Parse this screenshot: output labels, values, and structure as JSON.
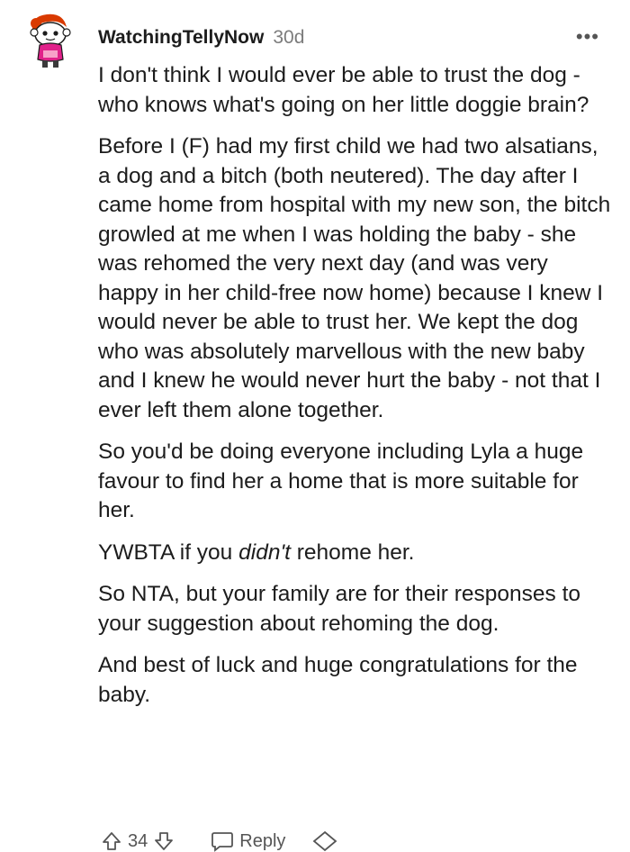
{
  "comment": {
    "username": "WatchingTellyNow",
    "age": "30d",
    "more": "•••",
    "paragraphs": [
      "I don't think I would ever be able to trust the dog - who knows what's going on her little doggie brain?",
      "Before I (F) had my first child we had two alsatians, a dog and a bitch (both neutered). The day after I came home from hospital with my new son, the bitch growled at me when I was holding the baby - she was rehomed the very next day (and was very happy in her child-free now home) because I knew I would never be able to trust her. We kept the dog who was absolutely marvellous with the new baby and I knew he would never hurt the baby - not that I ever left them alone together.",
      "So you'd be doing everyone including Lyla a huge favour to find her a home that is more suitable for her."
    ],
    "p4_before": "YWBTA if you ",
    "p4_italic": "didn't",
    "p4_after": " rehome her.",
    "paragraphs_end": [
      "So NTA, but your family are for their responses to your suggestion about rehoming the dog.",
      "And best of luck and huge congratulations for the baby."
    ]
  },
  "actions": {
    "vote_count": "34",
    "reply_label": "Reply"
  },
  "icons": {
    "avatar": "snoo-avatar-icon",
    "upvote": "upvote-arrow-icon",
    "downvote": "downvote-arrow-icon",
    "reply": "chat-bubble-icon",
    "award": "award-icon"
  },
  "colors": {
    "text": "#1c1c1c",
    "meta": "#7c7c7c",
    "avatar_hair": "#d93a00"
  }
}
